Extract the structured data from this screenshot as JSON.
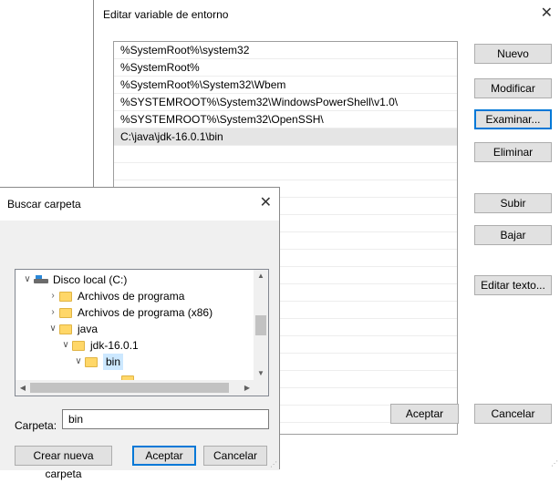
{
  "env_dialog": {
    "title": "Editar variable de entorno",
    "close_glyph": "✕",
    "paths": [
      "%SystemRoot%\\system32",
      "%SystemRoot%",
      "%SystemRoot%\\System32\\Wbem",
      "%SYSTEMROOT%\\System32\\WindowsPowerShell\\v1.0\\",
      "%SYSTEMROOT%\\System32\\OpenSSH\\",
      "C:\\java\\jdk-16.0.1\\bin",
      "",
      "",
      "",
      "",
      "",
      "",
      "",
      "",
      "",
      "",
      "",
      "",
      "",
      "",
      "",
      "",
      ""
    ],
    "selected_index": 5,
    "buttons": {
      "new": "Nuevo",
      "edit": "Modificar",
      "browse": "Examinar...",
      "delete": "Eliminar",
      "up": "Subir",
      "down": "Bajar",
      "edit_text": "Editar texto...",
      "ok": "Aceptar",
      "cancel": "Cancelar"
    }
  },
  "browse_dialog": {
    "title": "Buscar carpeta",
    "close_glyph": "✕",
    "tree": [
      {
        "label": "Disco local (C:)",
        "icon": "drive-icon",
        "chevron": "expanded"
      },
      {
        "label": "Archivos de programa",
        "icon": "folder-icon",
        "chevron": "collapsed"
      },
      {
        "label": "Archivos de programa (x86)",
        "icon": "folder-icon",
        "chevron": "collapsed"
      },
      {
        "label": "java",
        "icon": "folder-icon",
        "chevron": "expanded"
      },
      {
        "label": "jdk-16.0.1",
        "icon": "folder-icon",
        "chevron": "expanded"
      },
      {
        "label": "bin",
        "icon": "folder-icon",
        "chevron": "expanded",
        "selected": true
      }
    ],
    "folder_label": "Carpeta:",
    "folder_value": "bin",
    "buttons": {
      "new_folder": "Crear nueva carpeta",
      "ok": "Aceptar",
      "cancel": "Cancelar"
    }
  }
}
